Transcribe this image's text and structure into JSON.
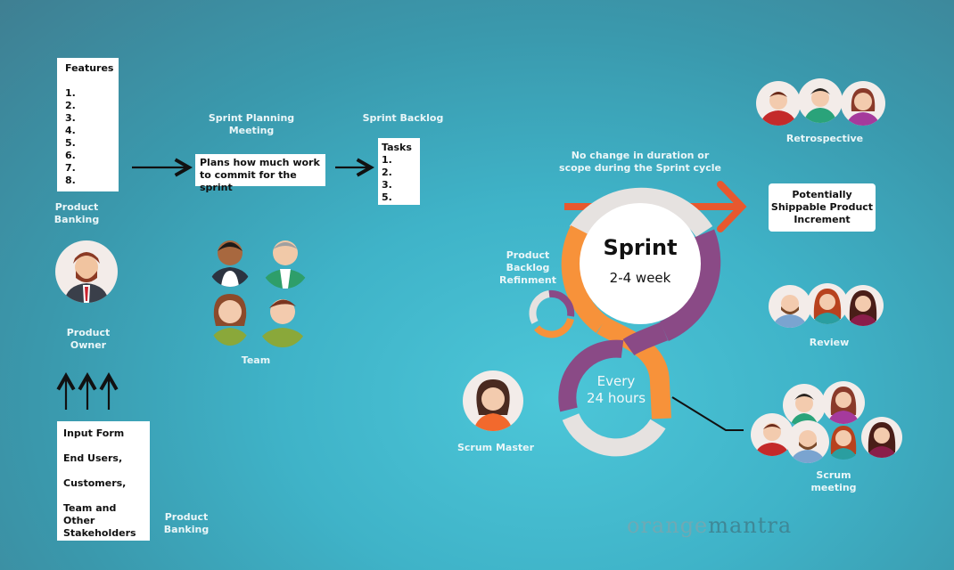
{
  "features": {
    "title": "Features",
    "items": [
      "1.",
      "2.",
      "3.",
      "4.",
      "5.",
      "6.",
      "7.",
      "8."
    ]
  },
  "product_banking_top": "Product\nBanking",
  "product_owner": "Product\nOwner",
  "input_form": {
    "lines": [
      "Input Form",
      "End Users,",
      "Customers,",
      "Team and Other Stakeholders"
    ]
  },
  "product_banking_bottom": "Product\nBanking",
  "sprint_planning": {
    "title": "Sprint Planning\nMeeting",
    "text": "Plans how much work\nto commit for the sprint"
  },
  "sprint_backlog": {
    "title": "Sprint Backlog",
    "box_title": "Tasks",
    "items": [
      "1.",
      "2.",
      "3.",
      "5."
    ]
  },
  "team_label": "Team",
  "no_change_note": "No change in duration or\nscope during the Sprint cycle",
  "sprint": {
    "title": "Sprint",
    "duration": "2-4 week"
  },
  "daily": {
    "text": "Every\n24 hours"
  },
  "refinement_label": "Product\nBacklog\nRefinment",
  "scrum_master_label": "Scrum Master",
  "retrospective_label": "Retrospective",
  "increment_box": "Potentially\nShippable Product\nIncrement",
  "review_label": "Review",
  "scrum_meeting_label": "Scrum\nmeeting",
  "watermark": {
    "part1": "orange",
    "part2": "mantra"
  },
  "colors": {
    "orange": "#f7923a",
    "purple": "#8a4a86",
    "grey": "#e6e2e0",
    "arrow_red": "#e8582e"
  }
}
